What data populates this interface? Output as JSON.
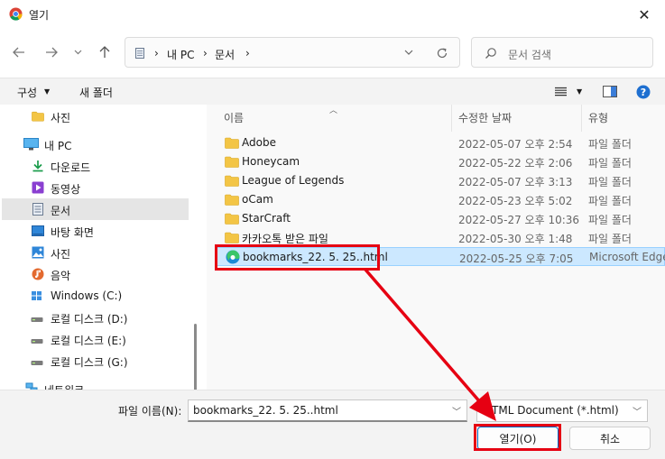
{
  "window": {
    "title": "열기"
  },
  "address": {
    "segments": [
      "내 PC",
      "문서"
    ]
  },
  "search": {
    "placeholder": "문서 검색"
  },
  "toolbar": {
    "organize": "구성",
    "new_folder": "새 폴더"
  },
  "sidebar": {
    "items": [
      {
        "label": "사진",
        "icon": "folder-icon"
      },
      {
        "label": "내 PC",
        "icon": "pc-icon"
      },
      {
        "label": "다운로드",
        "icon": "download-icon"
      },
      {
        "label": "동영상",
        "icon": "video-icon"
      },
      {
        "label": "문서",
        "icon": "document-icon"
      },
      {
        "label": "바탕 화면",
        "icon": "desktop-icon"
      },
      {
        "label": "사진",
        "icon": "pictures-icon"
      },
      {
        "label": "음악",
        "icon": "music-icon"
      },
      {
        "label": "Windows (C:)",
        "icon": "windows-drive-icon"
      },
      {
        "label": "로컬 디스크 (D:)",
        "icon": "drive-icon"
      },
      {
        "label": "로컬 디스크 (E:)",
        "icon": "drive-icon"
      },
      {
        "label": "로컬 디스크 (G:)",
        "icon": "drive-icon"
      },
      {
        "label": "네트워크",
        "icon": "network-icon"
      }
    ]
  },
  "columns": {
    "name": "이름",
    "date": "수정한 날짜",
    "type": "유형"
  },
  "files": [
    {
      "name": "Adobe",
      "date": "2022-05-07 오후 2:54",
      "type": "파일 폴더",
      "icon": "folder-icon"
    },
    {
      "name": "Honeycam",
      "date": "2022-05-22 오후 2:06",
      "type": "파일 폴더",
      "icon": "folder-icon"
    },
    {
      "name": "League of Legends",
      "date": "2022-05-07 오후 3:13",
      "type": "파일 폴더",
      "icon": "folder-icon"
    },
    {
      "name": "oCam",
      "date": "2022-05-23 오후 5:02",
      "type": "파일 폴더",
      "icon": "folder-icon"
    },
    {
      "name": "StarCraft",
      "date": "2022-05-27 오후 10:36",
      "type": "파일 폴더",
      "icon": "folder-icon"
    },
    {
      "name": "카카오톡 받은 파일",
      "date": "2022-05-30 오후 1:48",
      "type": "파일 폴더",
      "icon": "folder-icon"
    },
    {
      "name": "bookmarks_22. 5. 25..html",
      "date": "2022-05-25 오후 7:05",
      "type": "Microsoft Edge",
      "icon": "edge-icon"
    }
  ],
  "footer": {
    "filename_label": "파일 이름(N):",
    "filename_value": "bookmarks_22. 5. 25..html",
    "filetype_value": "HTML Document (*.html)",
    "open_label": "열기(O)",
    "cancel_label": "취소"
  },
  "colors": {
    "annotation": "#e60012",
    "selection": "#cce8ff",
    "folder": "#f3c545",
    "accent": "#0067c0"
  }
}
